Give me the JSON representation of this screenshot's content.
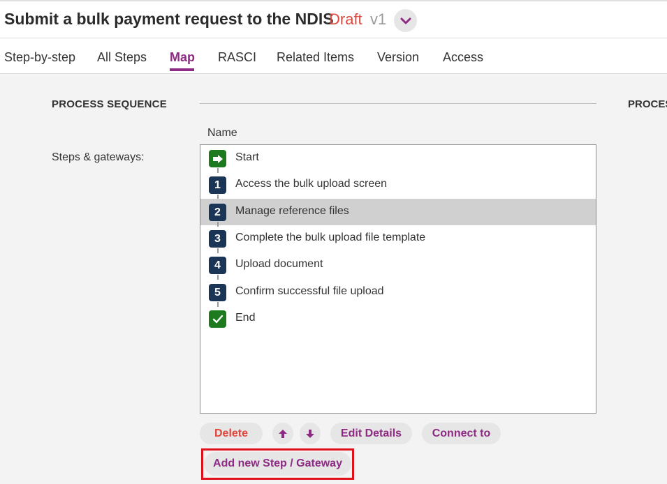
{
  "header": {
    "title": "Submit a bulk payment request to the NDIS",
    "status": "Draft",
    "version": "v1",
    "expand_icon": "chevron-down-icon",
    "accent_color": "#8e2a84",
    "status_color": "#e0463b"
  },
  "tabs": [
    {
      "label": "Step-by-step"
    },
    {
      "label": "All Steps"
    },
    {
      "label": "Map",
      "active": true
    },
    {
      "label": "RASCI"
    },
    {
      "label": "Related Items"
    },
    {
      "label": "Version"
    },
    {
      "label": "Access"
    }
  ],
  "section": {
    "title": "PROCESS SEQUENCE",
    "right_title": "PROCES",
    "column_header": "Name",
    "field_label": "Steps & gateways:"
  },
  "steps": [
    {
      "badge": "",
      "label": "Start",
      "type": "start",
      "icon": "arrow-right-icon"
    },
    {
      "badge": "1",
      "label": "Access the bulk upload screen",
      "type": "step"
    },
    {
      "badge": "2",
      "label": "Manage reference files",
      "type": "step",
      "selected": true
    },
    {
      "badge": "3",
      "label": "Complete the bulk upload file template",
      "type": "step"
    },
    {
      "badge": "4",
      "label": "Upload document",
      "type": "step"
    },
    {
      "badge": "5",
      "label": "Confirm successful file upload",
      "type": "step"
    },
    {
      "badge": "",
      "label": "End",
      "type": "end",
      "icon": "check-icon"
    }
  ],
  "actions": {
    "delete": "Delete",
    "move_up_icon": "arrow-up-icon",
    "move_down_icon": "arrow-down-icon",
    "edit": "Edit Details",
    "connect": "Connect to",
    "add": "Add new Step / Gateway"
  }
}
